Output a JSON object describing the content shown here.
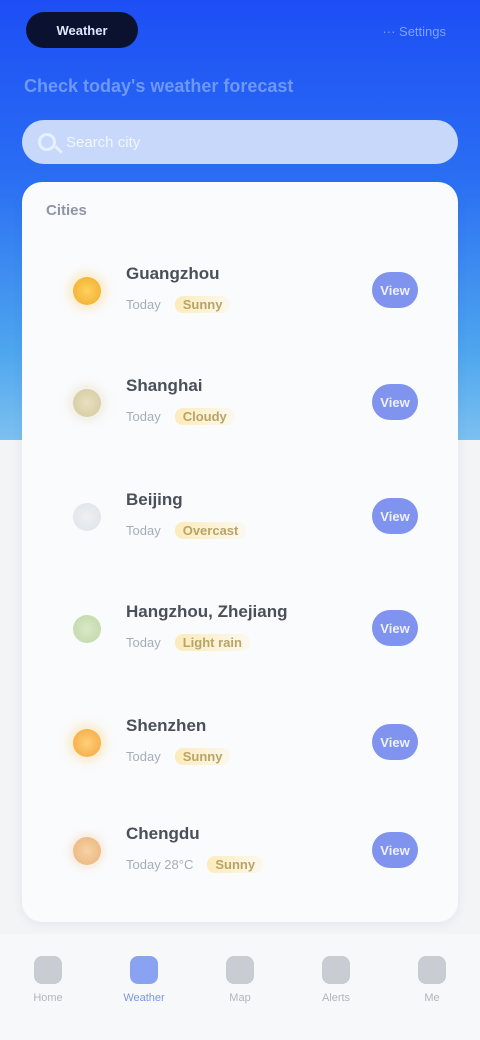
{
  "topbar": {
    "app_label": "Weather",
    "right_text": "···  Settings"
  },
  "subtitle": "Check today's weather forecast",
  "search": {
    "placeholder": "Search city"
  },
  "list": {
    "title": "Cities",
    "rows": [
      {
        "name": "Guangzhou",
        "sub": "Today",
        "tag": "Sunny",
        "icon": "sun-icon",
        "button": "View"
      },
      {
        "name": "Shanghai",
        "sub": "Today",
        "tag": "Cloudy",
        "icon": "partly-cloudy-icon",
        "button": "View"
      },
      {
        "name": "Beijing",
        "sub": "Today",
        "tag": "Overcast",
        "icon": "cloud-icon",
        "button": "View"
      },
      {
        "name": "Hangzhou, Zhejiang",
        "sub": "Today",
        "tag": "Light rain",
        "icon": "rain-icon",
        "button": "View"
      },
      {
        "name": "Shenzhen",
        "sub": "Today",
        "tag": "Sunny",
        "icon": "sun-icon",
        "button": "View"
      },
      {
        "name": "Chengdu",
        "sub": "Today 28°C",
        "tag": "Sunny",
        "icon": "sun-icon",
        "button": "View"
      }
    ]
  },
  "bottom_nav": [
    {
      "label": "Home",
      "icon": "home-icon"
    },
    {
      "label": "Weather",
      "icon": "weather-icon"
    },
    {
      "label": "Map",
      "icon": "map-icon"
    },
    {
      "label": "Alerts",
      "icon": "bell-icon"
    },
    {
      "label": "Me",
      "icon": "user-icon"
    }
  ],
  "colors": {
    "header_top": "#1d4ef5",
    "header_bottom": "#7cc0f0",
    "button": "#7f93ef",
    "active_nav": "#8aa2f2"
  }
}
